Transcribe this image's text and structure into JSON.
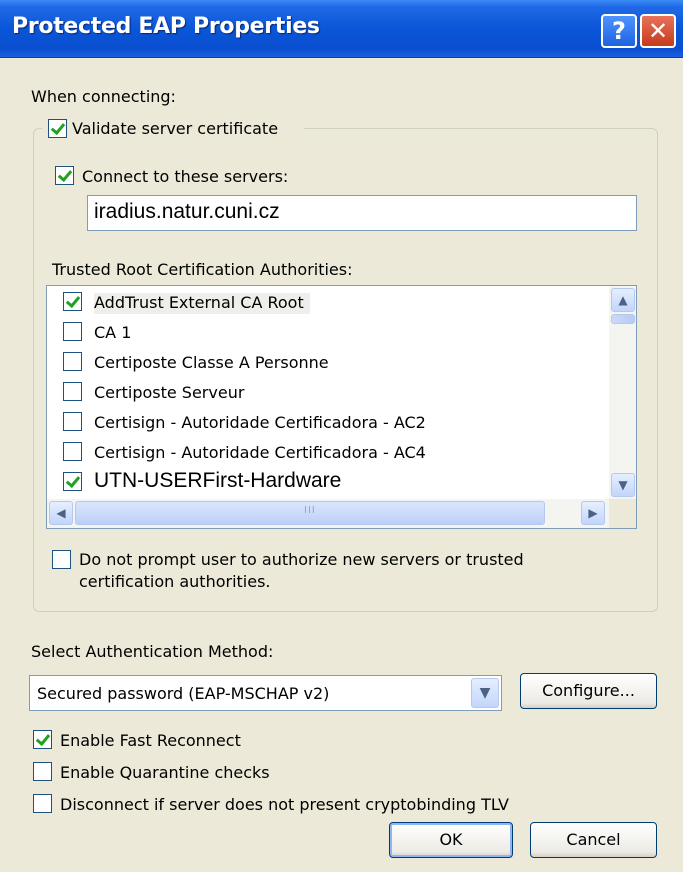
{
  "window": {
    "title": "Protected EAP Properties",
    "help_glyph": "?",
    "close_glyph": "✕"
  },
  "when_connecting_label": "When connecting:",
  "validate_cert": {
    "label": "Validate server certificate",
    "checked": true
  },
  "connect_servers": {
    "label": "Connect to these servers:",
    "checked": true,
    "value": "iradius.natur.cuni.cz"
  },
  "trusted_root_label": "Trusted Root Certification Authorities:",
  "ca_list": [
    {
      "name": "AddTrust External CA Root",
      "checked": true
    },
    {
      "name": "CA 1",
      "checked": false
    },
    {
      "name": "Certiposte Classe A Personne",
      "checked": false
    },
    {
      "name": "Certiposte Serveur",
      "checked": false
    },
    {
      "name": "Certisign - Autoridade Certificadora - AC2",
      "checked": false
    },
    {
      "name": "Certisign - Autoridade Certificadora - AC4",
      "checked": false
    },
    {
      "name": "UTN-USERFirst-Hardware",
      "checked": true
    }
  ],
  "scroll": {
    "up": "▲",
    "down": "▼",
    "left": "◀",
    "right": "▶",
    "grip": "III"
  },
  "no_prompt": {
    "line1": "Do not prompt user to authorize new servers or trusted",
    "line2": "certification authorities.",
    "checked": false
  },
  "auth_method_label": "Select Authentication Method:",
  "auth_method": {
    "selected": "Secured password (EAP-MSCHAP v2)",
    "arrow": "▼"
  },
  "configure_button": "Configure...",
  "fast_reconnect": {
    "label": "Enable Fast Reconnect",
    "checked": true
  },
  "quarantine": {
    "label": "Enable Quarantine checks",
    "checked": false
  },
  "cryptobinding": {
    "label": "Disconnect if server does not present cryptobinding TLV",
    "checked": false
  },
  "ok_button": "OK",
  "cancel_button": "Cancel",
  "colors": {
    "titlebar": "#0a56d8",
    "face": "#ece9d8",
    "check": "#21a121"
  }
}
